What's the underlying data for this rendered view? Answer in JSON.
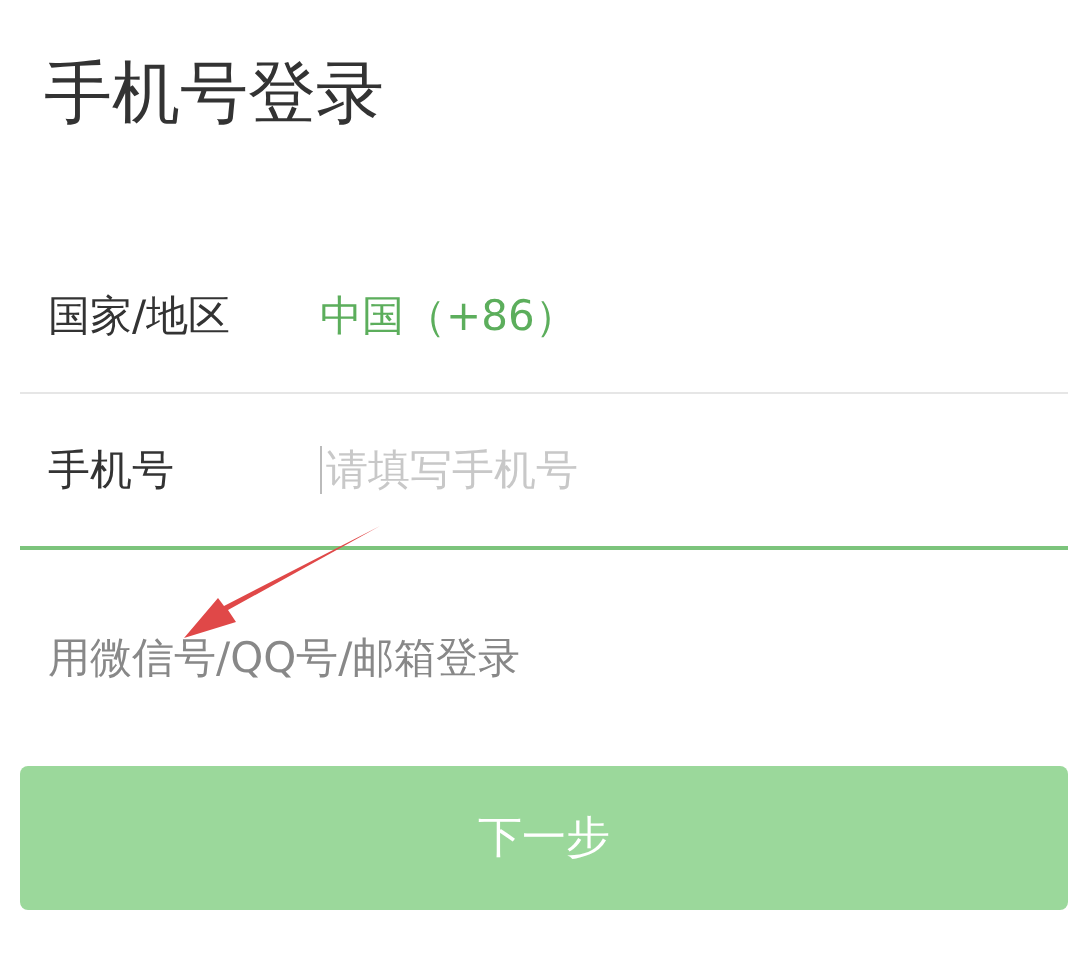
{
  "title": "手机号登录",
  "region": {
    "label": "国家/地区",
    "value": "中国（+86）"
  },
  "phone": {
    "label": "手机号",
    "placeholder": "请填写手机号",
    "focused": true
  },
  "alt_login_link": "用微信号/QQ号/邮箱登录",
  "next_button": {
    "label": "下一步",
    "disabled": true
  }
}
